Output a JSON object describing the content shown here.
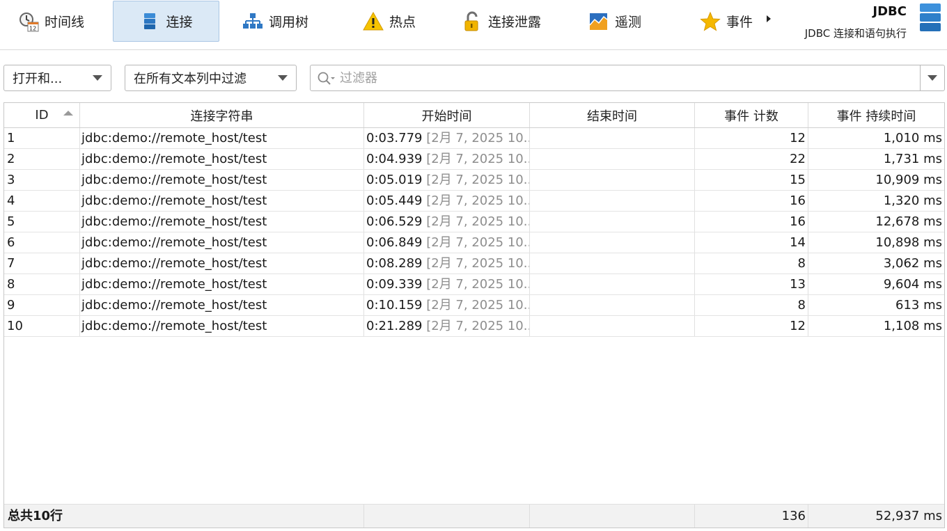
{
  "toolbar": {
    "tabs": [
      {
        "label": "时间线",
        "icon": "timeline-clock-icon"
      },
      {
        "label": "连接",
        "icon": "database-icon",
        "active": true
      },
      {
        "label": "调用树",
        "icon": "call-tree-icon"
      },
      {
        "label": "热点",
        "icon": "warning-triangle-icon"
      },
      {
        "label": "连接泄露",
        "icon": "unlocked-padlock-icon"
      },
      {
        "label": "遥测",
        "icon": "telemetry-chart-icon"
      },
      {
        "label": "事件",
        "icon": "star-icon"
      }
    ],
    "title": "JDBC",
    "subtitle": "JDBC 连接和语句执行",
    "title_icon": "database-stack-icon"
  },
  "filters": {
    "state_combo": "打开和...",
    "scope_combo": "在所有文本列中过滤",
    "search_placeholder": "过滤器",
    "search_value": ""
  },
  "table": {
    "columns": [
      "ID",
      "连接字符串",
      "开始时间",
      "结束时间",
      "事件 计数",
      "事件 持续时间"
    ],
    "sort_column": "ID",
    "sort_direction": "ascending",
    "rows": [
      {
        "id": "1",
        "conn": "jdbc:demo://remote_host/test",
        "start": "0:03.779",
        "start_date": "[2月 7, 2025 10...",
        "end": "",
        "count": "12",
        "duration": "1,010 ms"
      },
      {
        "id": "2",
        "conn": "jdbc:demo://remote_host/test",
        "start": "0:04.939",
        "start_date": "[2月 7, 2025 10...",
        "end": "",
        "count": "22",
        "duration": "1,731 ms"
      },
      {
        "id": "3",
        "conn": "jdbc:demo://remote_host/test",
        "start": "0:05.019",
        "start_date": "[2月 7, 2025 10...",
        "end": "",
        "count": "15",
        "duration": "10,909 ms"
      },
      {
        "id": "4",
        "conn": "jdbc:demo://remote_host/test",
        "start": "0:05.449",
        "start_date": "[2月 7, 2025 10...",
        "end": "",
        "count": "16",
        "duration": "1,320 ms"
      },
      {
        "id": "5",
        "conn": "jdbc:demo://remote_host/test",
        "start": "0:06.529",
        "start_date": "[2月 7, 2025 10...",
        "end": "",
        "count": "16",
        "duration": "12,678 ms"
      },
      {
        "id": "6",
        "conn": "jdbc:demo://remote_host/test",
        "start": "0:06.849",
        "start_date": "[2月 7, 2025 10...",
        "end": "",
        "count": "14",
        "duration": "10,898 ms"
      },
      {
        "id": "7",
        "conn": "jdbc:demo://remote_host/test",
        "start": "0:08.289",
        "start_date": "[2月 7, 2025 10...",
        "end": "",
        "count": "8",
        "duration": "3,062 ms"
      },
      {
        "id": "8",
        "conn": "jdbc:demo://remote_host/test",
        "start": "0:09.339",
        "start_date": "[2月 7, 2025 10...",
        "end": "",
        "count": "13",
        "duration": "9,604 ms"
      },
      {
        "id": "9",
        "conn": "jdbc:demo://remote_host/test",
        "start": "0:10.159",
        "start_date": "[2月 7, 2025 10...",
        "end": "",
        "count": "8",
        "duration": "613 ms"
      },
      {
        "id": "10",
        "conn": "jdbc:demo://remote_host/test",
        "start": "0:21.289",
        "start_date": "[2月 7, 2025 10...",
        "end": "",
        "count": "12",
        "duration": "1,108 ms"
      }
    ],
    "footer": {
      "label_prefix": "总共",
      "label_count": "10行",
      "count_total": "136",
      "duration_total": "52,937 ms"
    }
  }
}
